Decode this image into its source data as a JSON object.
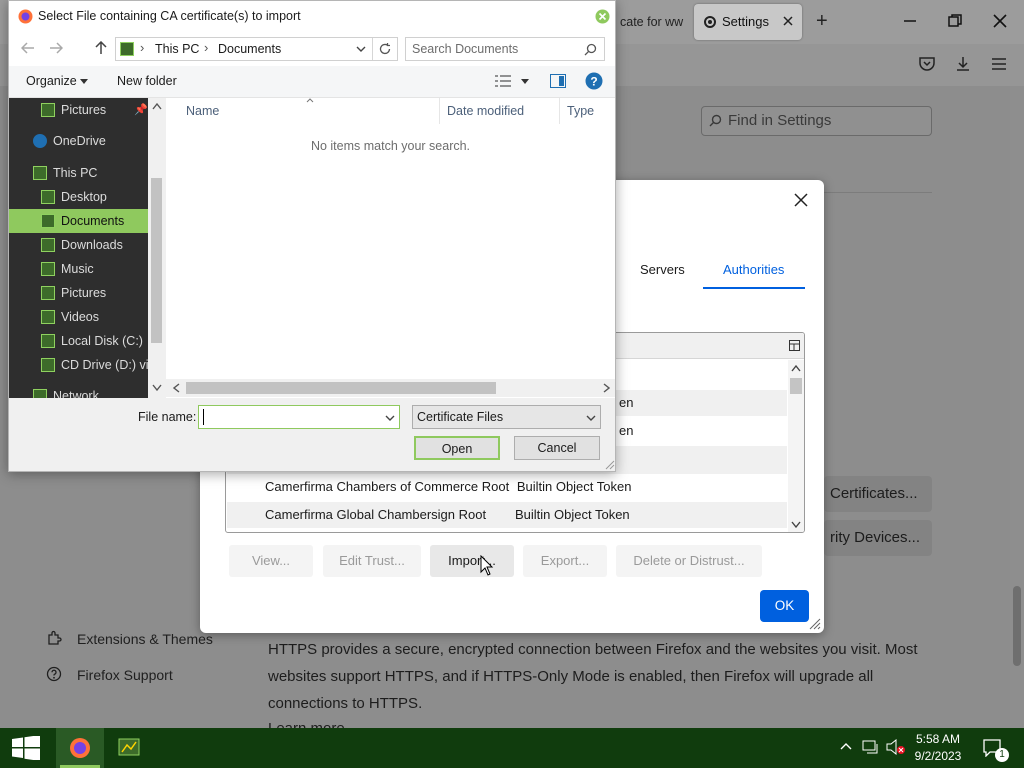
{
  "browser": {
    "tabs": [
      {
        "label": "cate for ww"
      },
      {
        "label": "Settings"
      }
    ],
    "new_tab_symbol": "+",
    "find_placeholder": "Find in Settings"
  },
  "settings": {
    "btn_certificates": "Certificates...",
    "btn_security_devices": "rity Devices...",
    "sidebar": [
      {
        "label": "Extensions & Themes",
        "icon": "puzzle-icon"
      },
      {
        "label": "Firefox Support",
        "icon": "help-icon"
      }
    ],
    "https_text": "HTTPS provides a secure, encrypted connection between Firefox and the websites you visit. Most websites support HTTPS, and if HTTPS-Only Mode is enabled, then Firefox will upgrade all connections to HTTPS.",
    "learn_more": "Learn more"
  },
  "cert_manager": {
    "tabs": [
      {
        "label": "Servers"
      },
      {
        "label": "Authorities"
      }
    ],
    "active_tab": "Authorities",
    "rows_partial": [
      "en",
      "en"
    ],
    "rows": [
      {
        "name": "Camerfirma Chambers of Commerce Root",
        "device": "Builtin Object Token"
      },
      {
        "name": "Camerfirma Global Chambersign Root",
        "device": "Builtin Object Token"
      }
    ],
    "buttons": {
      "view": "View...",
      "edit_trust": "Edit Trust...",
      "import": "Import...",
      "export": "Export...",
      "delete": "Delete or Distrust..."
    },
    "ok": "OK"
  },
  "file_dialog": {
    "title": "Select File containing CA certificate(s) to import",
    "breadcrumb": [
      "This PC",
      "Documents"
    ],
    "search_placeholder": "Search Documents",
    "organize": "Organize",
    "new_folder": "New folder",
    "nav": [
      {
        "label": "Pictures",
        "pinned": true
      },
      {
        "label": "OneDrive"
      },
      {
        "label": "This PC"
      },
      {
        "label": "Desktop"
      },
      {
        "label": "Documents",
        "selected": true
      },
      {
        "label": "Downloads"
      },
      {
        "label": "Music"
      },
      {
        "label": "Pictures"
      },
      {
        "label": "Videos"
      },
      {
        "label": "Local Disk (C:)"
      },
      {
        "label": "CD Drive (D:) virt"
      },
      {
        "label": "Network"
      }
    ],
    "columns": [
      "Name",
      "Date modified",
      "Type"
    ],
    "empty_message": "No items match your search.",
    "file_name_label": "File name:",
    "file_name_value": "",
    "file_type": "Certificate Files",
    "open": "Open",
    "cancel": "Cancel"
  },
  "taskbar": {
    "time": "5:58 AM",
    "date": "9/2/2023",
    "notification_count": "1"
  },
  "colors": {
    "accent": "#0060df",
    "taskbar": "#103c0d",
    "selected_nav": "#8fc95e"
  }
}
